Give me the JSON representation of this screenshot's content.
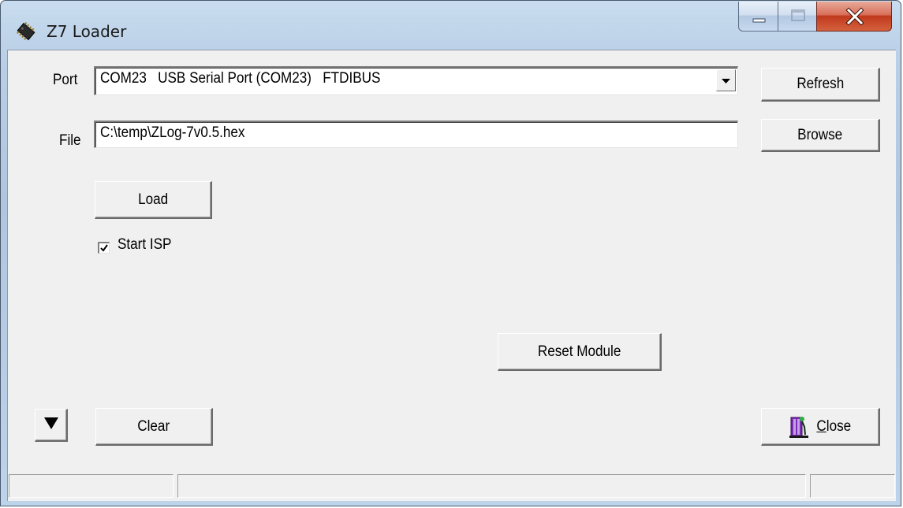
{
  "window": {
    "title": "Z7 Loader",
    "icon": "chip-icon",
    "controls": [
      "minimize-icon",
      "maximize-icon",
      "close-icon"
    ]
  },
  "port": {
    "label": "Port",
    "selected": "COM23   USB Serial Port (COM23)   FTDIBUS",
    "refresh_label": "Refresh"
  },
  "file": {
    "label": "File",
    "value": "C:\\temp\\ZLog-7v0.5.hex",
    "browse_label": "Browse"
  },
  "actions": {
    "load_label": "Load",
    "start_isp_label": "Start ISP",
    "start_isp_checked": true,
    "reset_label": "Reset Module",
    "clear_label": "Clear",
    "close_label": "Close",
    "close_underline": "C",
    "expand_icon": "triangle-down-icon"
  },
  "statusbar": {
    "panes": [
      "",
      "",
      ""
    ]
  },
  "colors": {
    "dialog_bg": "#f0f0f0",
    "frame": "#b9cfe6",
    "close_button": "#c0391c"
  }
}
